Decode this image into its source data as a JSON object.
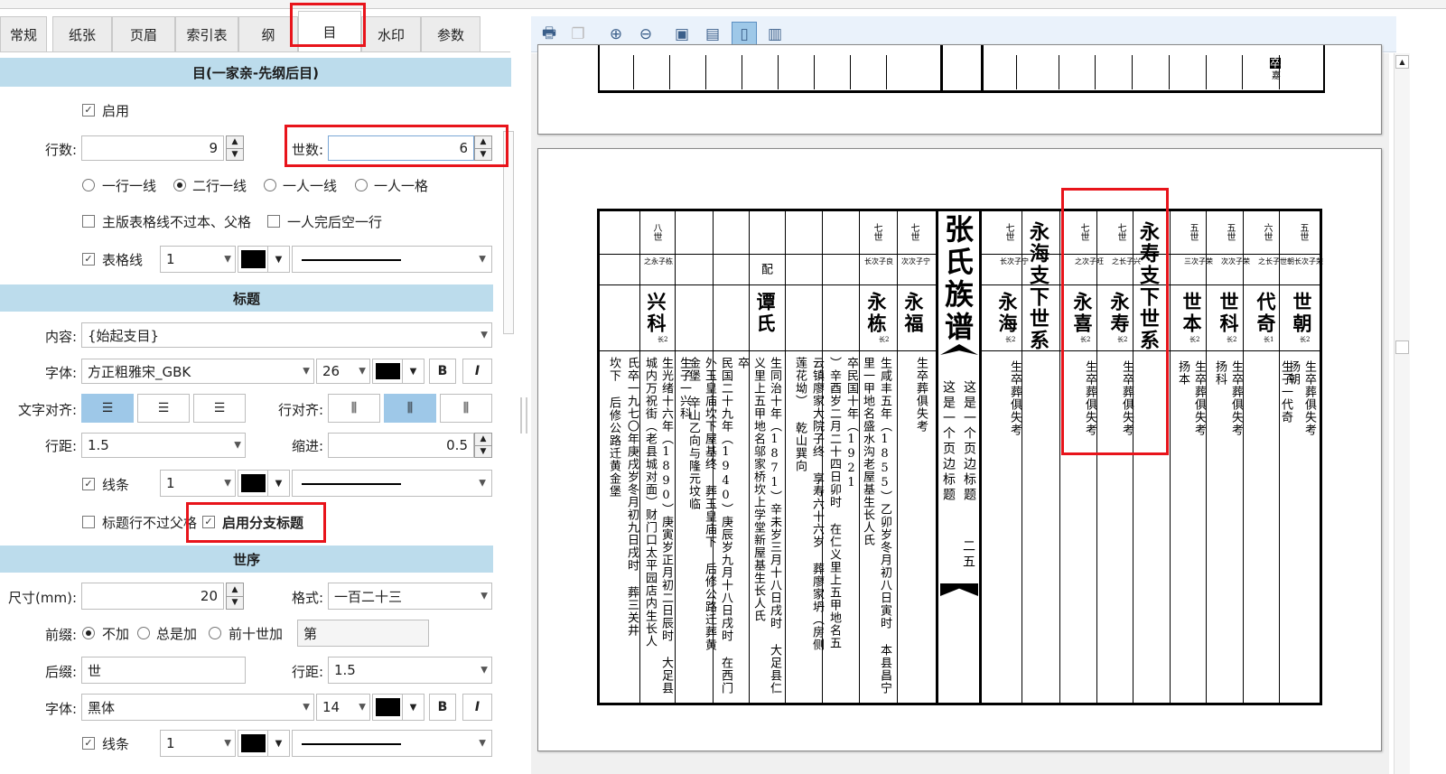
{
  "tabs": [
    "常规",
    "纸张",
    "页眉",
    "索引表",
    "纲",
    "目",
    "水印",
    "参数"
  ],
  "mu": {
    "section_title": "目(一家亲-先纲后目)",
    "enable_label": "启用",
    "rows_label": "行数:",
    "rows_value": "9",
    "gen_label": "世数:",
    "gen_value": "6",
    "radio_options": [
      "一行一线",
      "二行一线",
      "一人一线",
      "一人一格"
    ],
    "radio_selected": 1,
    "opt_main_border": "主版表格线不过本、父格",
    "opt_blank_row": "一人完后空一行",
    "gridline_label": "表格线",
    "gridline_width": "1"
  },
  "title": {
    "section_title": "标题",
    "content_label": "内容:",
    "content_value": "{始起支目}",
    "font_label": "字体:",
    "font_value": "方正粗雅宋_GBK",
    "font_size": "26",
    "bold": "B",
    "italic": "I",
    "align_label": "文字对齐:",
    "row_align_label": "行对齐:",
    "spacing_label": "行距:",
    "spacing_value": "1.5",
    "indent_label": "缩进:",
    "indent_value": "0.5",
    "line_label": "线条",
    "line_width": "1",
    "no_parent_label": "标题行不过父格",
    "branch_title_label": "启用分支标题"
  },
  "order": {
    "section_title": "世序",
    "size_label": "尺寸(mm):",
    "size_value": "20",
    "format_label": "格式:",
    "format_value": "一百二十三",
    "prefix_label": "前缀:",
    "prefix_options": [
      "不加",
      "总是加",
      "前十世加"
    ],
    "prefix_selected": 0,
    "prefix_value": "第",
    "suffix_label": "后缀:",
    "suffix_value": "世",
    "spacing_label": "行距:",
    "spacing_value": "1.5",
    "font_label": "字体:",
    "font_value": "黑体",
    "font_size": "14",
    "bold": "B",
    "italic": "I",
    "line_label": "线条",
    "line_width": "1"
  },
  "toolbar_icons": [
    "print-icon",
    "copy-icon",
    "zoom-in-icon",
    "zoom-out-icon",
    "fit-page-icon",
    "fit-width-icon",
    "single-page-icon",
    "two-page-icon"
  ],
  "genealogy": {
    "book_title": "张氏族谱",
    "edge_title_a": "这是一个页边标题",
    "edge_title_b": "这是一个页边标题",
    "page_number": "二五",
    "branch_a": "永海支下世系",
    "branch_b": "永寿支下世系",
    "pei": "配",
    "top_mark": "卒",
    "top_mark_sub": "嘉",
    "columns": [
      {
        "gen": "五世",
        "rel": "长次子荣",
        "name": "世朝",
        "sub": "长2",
        "bio": "生卒葬俱失考",
        "son": "扬朝",
        "extra": "生子一代奇"
      },
      {
        "gen": "六世",
        "rel": "之长子世朝",
        "name": "代奇",
        "sub": "长1",
        "bio": "",
        "son": "",
        "extra": ""
      },
      {
        "gen": "五世",
        "rel": "次次子荣",
        "name": "世科",
        "sub": "长2",
        "bio": "生卒葬俱失考",
        "son": "扬科",
        "extra": ""
      },
      {
        "gen": "五世",
        "rel": "三次子荣",
        "name": "世本",
        "sub": "长2",
        "bio": "生卒葬俱失考",
        "son": "扬本",
        "extra": ""
      },
      {
        "gen": "七世",
        "rel": "之长子兴",
        "name": "永寿",
        "sub": "长2",
        "bio": "生卒葬俱失考"
      },
      {
        "gen": "七世",
        "rel": "之次子旺",
        "name": "永喜",
        "sub": "长2",
        "bio": "生卒葬俱失考"
      },
      {
        "gen": "七世",
        "rel": "长次子宁",
        "name": "永海",
        "sub": "长2",
        "bio": "生卒葬俱失考"
      },
      {
        "gen": "七世",
        "rel": "次次子宁",
        "name": "永福",
        "sub": "长2",
        "bio": "生卒葬俱失考"
      },
      {
        "gen": "七世",
        "rel": "长次子良",
        "name": "永栋",
        "sub": "长2",
        "bio1": "生咸丰五年（1855）乙卯岁冬月初八日寅时  本县昌宁",
        "bio2": "里一甲地名盛水沟老屋基生长人氏",
        "bio3": "卒民国十年（1921",
        "bio4": "）辛酉岁二月二十四日卯时  在仁义里上五甲地名五",
        "bio5": "云镇廖家大院子终  享寿六十六岁  葬廖家坍（房侧",
        "bio6": "莲花坳）  乾山巽向"
      },
      {
        "name": "谭氏",
        "bio1": "生同治十年（1871）辛未岁三月十八日戌时  大足县仁",
        "bio2": "义里上五甲地名邬家桥坎上学堂新屋基生长人氏",
        "bio3": "卒",
        "bio4": "民国二十九年（1940）庚辰岁九月十八日戌时  在西门",
        "bio5": "外玉皇庙坎下屋基终  葬玉皇庙下  后修公路迁葬黄",
        "bio6": "金堡  辛山乙向与隆元坟临"
      },
      {
        "gen": "八世",
        "rel": "之永子栋",
        "name": "兴科",
        "sub": "长2",
        "bio1": "生子一兴科",
        "bio2": "生光绪十六年（1890）庚寅岁正月初二日辰时  大足县",
        "bio3": "城内万祝街（老县城对面）财门口太平园店内生长人",
        "bio4": "氏卒一九七〇年庚戌岁冬月初九日戌时  葬三关井",
        "bio5": "坎下  后修公路迁黄金堡"
      }
    ]
  }
}
